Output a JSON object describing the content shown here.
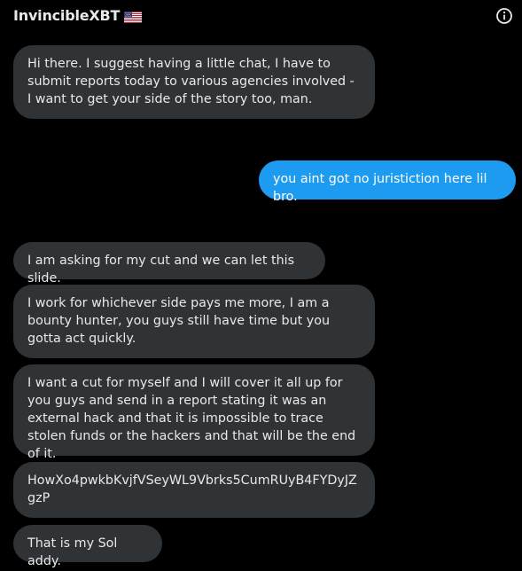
{
  "header": {
    "title": "InvincibleXBT",
    "flag_icon": "us-flag-icon",
    "info_icon": "info-circle-icon"
  },
  "colors": {
    "background": "#000000",
    "incoming_bubble": "#2f3336",
    "outgoing_bubble": "#1d9bf0",
    "text": "#e7e9ea"
  },
  "messages": [
    {
      "direction": "incoming",
      "text": "Hi there. I suggest having a little chat, I have to submit reports today to various agencies involved - I want to get your side of the story too, man."
    },
    {
      "direction": "outgoing",
      "text": "you aint got no juristiction here lil bro."
    },
    {
      "direction": "incoming",
      "text": "I am asking for my cut and we can let this slide."
    },
    {
      "direction": "incoming",
      "text": "I work for whichever side pays me more, I am a bounty hunter, you guys still have time but you gotta act quickly."
    },
    {
      "direction": "incoming",
      "text": "I want a cut for myself and I will cover it all up for you guys and send in a report stating it was an external hack and that it is impossible to trace stolen funds or the hackers and that will be the end of it."
    },
    {
      "direction": "incoming",
      "text": "HowXo4pwkbKvjfVSeyWL9Vbrks5CumRUyB4FYDyJZgzP"
    },
    {
      "direction": "incoming",
      "text": "That is my Sol addy."
    }
  ]
}
